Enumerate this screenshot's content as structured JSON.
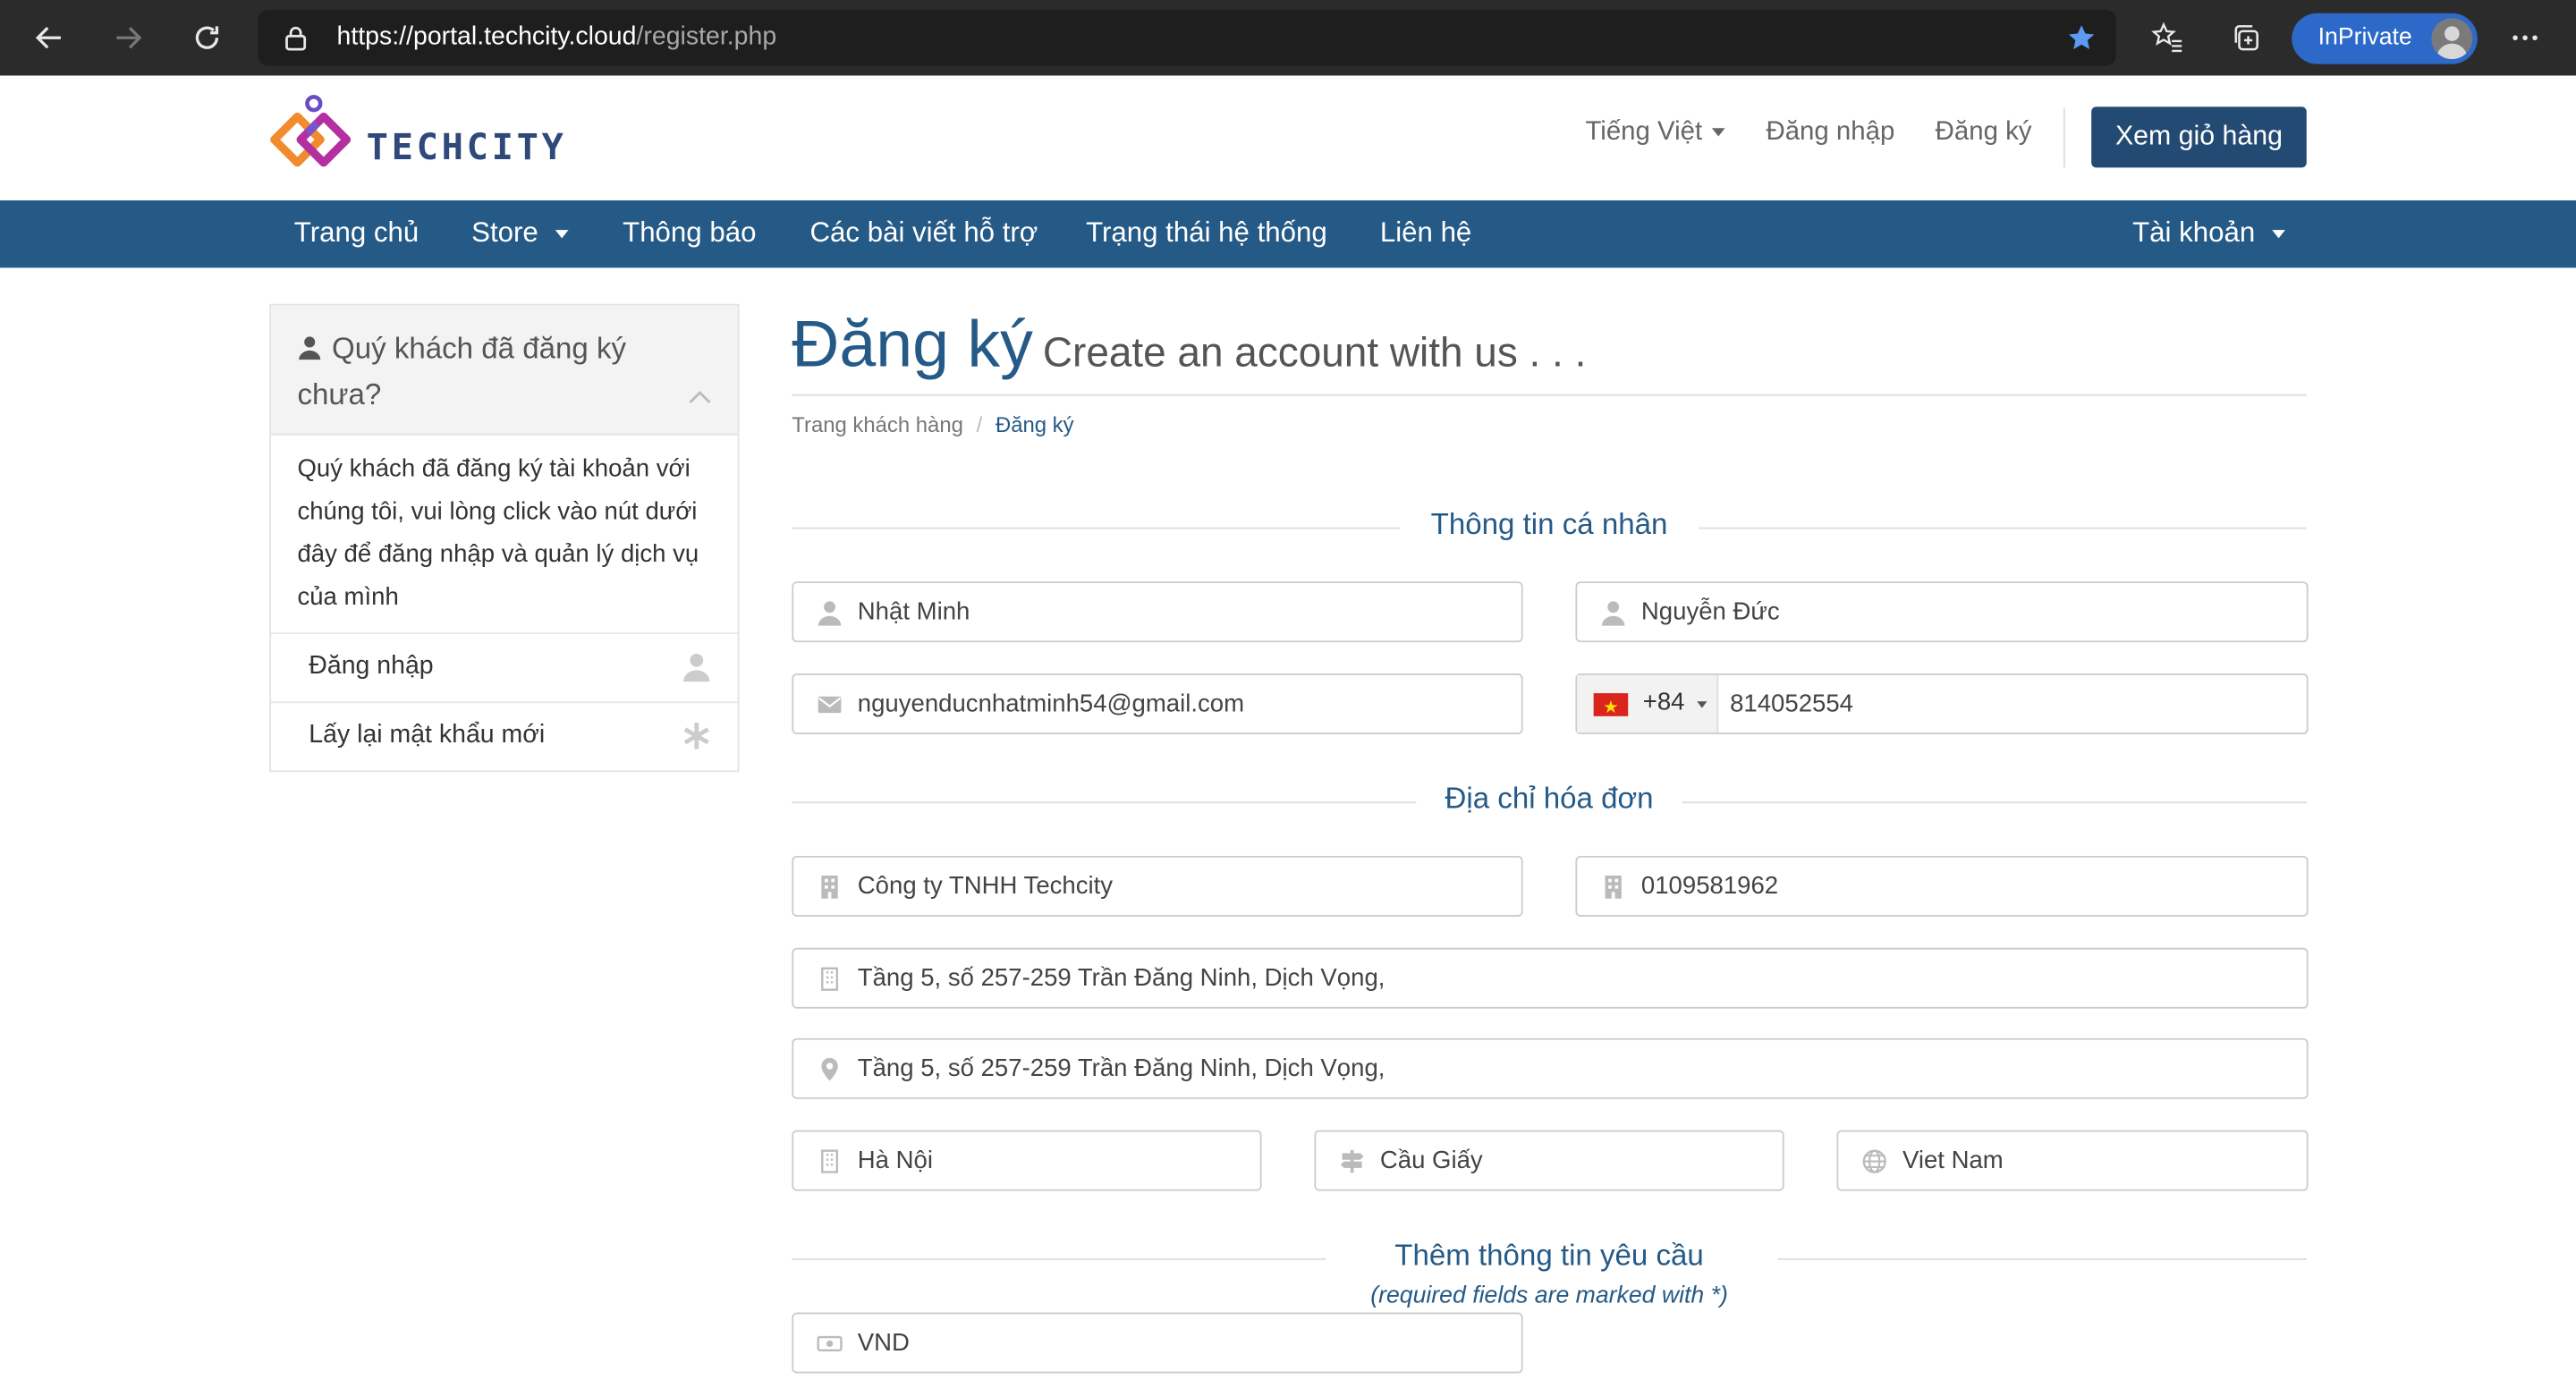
{
  "browser": {
    "url_host": "https://portal.techcity.cloud",
    "url_path": "/register.php",
    "inprivate_label": "InPrivate"
  },
  "header": {
    "logo_text": "TECHCITY",
    "language": "Tiếng Việt",
    "login": "Đăng nhập",
    "register": "Đăng ký",
    "cart_button": "Xem giỏ hàng"
  },
  "nav": {
    "items": [
      "Trang chủ",
      "Store",
      "Thông báo",
      "Các bài viết hỗ trợ",
      "Trạng thái hệ thống",
      "Liên hệ"
    ],
    "account": "Tài khoản"
  },
  "sidebar": {
    "title": "Quý khách đã đăng ký chưa?",
    "body": "Quý khách đã đăng ký tài khoản với chúng tôi, vui lòng click vào nút dưới đây để đăng nhập và quản lý dịch vụ của mình",
    "items": [
      {
        "label": "Đăng nhập",
        "icon": "user-icon"
      },
      {
        "label": "Lấy lại mật khẩu mới",
        "icon": "asterisk-icon"
      }
    ]
  },
  "page": {
    "title": "Đăng ký",
    "subtitle": "Create an account with us . . .",
    "breadcrumb": [
      "Trang khách hàng",
      "Đăng ký"
    ]
  },
  "sections": {
    "personal": "Thông tin cá nhân",
    "billing": "Địa chỉ hóa đơn",
    "additional": "Thêm thông tin yêu cầu",
    "required_note": "(required fields are marked with *)"
  },
  "form": {
    "first_name": "Nhật Minh",
    "last_name": "Nguyễn Đức",
    "email": "nguyenducnhatminh54@gmail.com",
    "phone_prefix": "+84",
    "phone": "814052554",
    "company": "Công ty TNHH Techcity",
    "tax_id": "0109581962",
    "address1": "Tầng 5, số 257-259 Trần Đăng Ninh, Dịch Vọng,",
    "address2": "Tầng 5, số 257-259 Trần Đăng Ninh, Dịch Vọng,",
    "city": "Hà Nội",
    "state": "Cầu Giấy",
    "country": "Viet Nam",
    "currency": "VND"
  }
}
